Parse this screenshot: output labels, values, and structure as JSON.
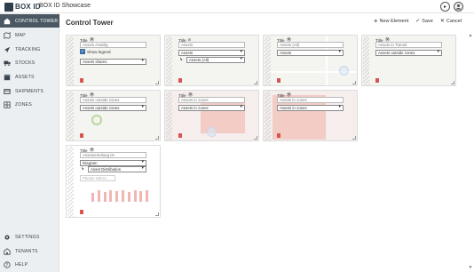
{
  "app": {
    "logo_text": "BOX ID",
    "title": "BOX ID Showcase"
  },
  "topbar_icons": [
    "forward-icon",
    "user-avatar-icon"
  ],
  "sidebar": {
    "items": [
      {
        "label": "CONTROL TOWER",
        "icon": "building-icon",
        "active": true
      },
      {
        "label": "MAP",
        "icon": "map-icon"
      },
      {
        "label": "TRACKING",
        "icon": "navigation-icon"
      },
      {
        "label": "STOCKS",
        "icon": "truck-icon"
      },
      {
        "label": "ASSETS",
        "icon": "box-icon"
      },
      {
        "label": "SHIPMENTS",
        "icon": "shipment-icon"
      },
      {
        "label": "ZONES",
        "icon": "zones-icon"
      }
    ],
    "bottom_items": [
      {
        "label": "SETTINGS",
        "icon": "gear-icon"
      },
      {
        "label": "TENANTS",
        "icon": "tenants-icon"
      },
      {
        "label": "HELP",
        "icon": "help-icon"
      }
    ]
  },
  "main": {
    "page_title": "Control Tower",
    "actions": {
      "new_element": "New Element",
      "save": "Save",
      "cancel": "Cancel"
    }
  },
  "widgets": [
    {
      "title_label": "Title",
      "title_value": "Assets Anteilig",
      "show_legend_label": "Show legend",
      "show_legend_checked": true,
      "select1": "Assets shares"
    },
    {
      "title_label": "Title",
      "title_value": "Assets",
      "select1": "Assets",
      "select2": "Assets (All)"
    },
    {
      "title_label": "Title",
      "title_value": "Assets (All)",
      "select1": "Assets"
    },
    {
      "title_label": "Title",
      "title_value": "Assets in Transit",
      "select1": "Assets outside zones"
    },
    {
      "title_label": "Title",
      "title_value": "Assets outside zones",
      "select1": "Assets outside zones"
    },
    {
      "title_label": "Title",
      "title_value": "Assets in zones",
      "select1": "Assets in zones"
    },
    {
      "title_label": "Title",
      "title_value": "Assets in zones",
      "select1": "Assets in zones"
    },
    {
      "title_label": "Title",
      "title_value": "Assetverteilung IN",
      "select1": "Diagram",
      "select2": "Asset Distribution",
      "placeholder": "Please select...",
      "bar_levels": [
        0.55,
        0.7,
        0.6,
        0.75,
        0.65,
        0.7,
        0.6,
        0.7,
        0.65,
        0.72
      ]
    }
  ]
}
